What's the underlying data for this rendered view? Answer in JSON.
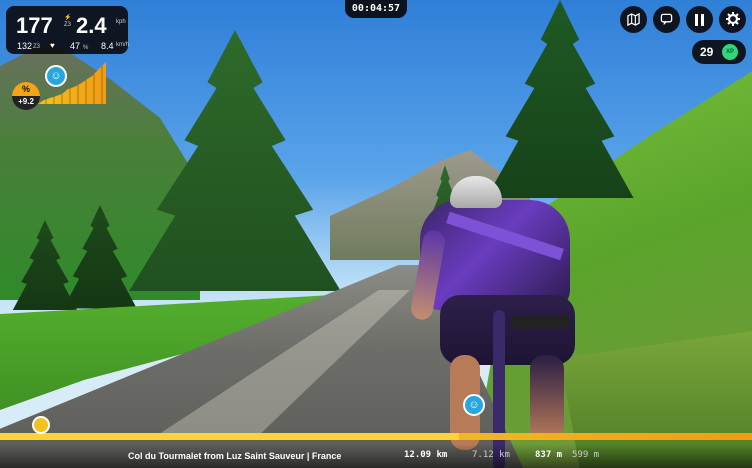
{
  "stats": {
    "power": "177",
    "power_zone_top": "⚡",
    "power_zone": "Z3",
    "speed": "2.4",
    "speed_unit": "kph",
    "heart_rate": "132",
    "heart_zone": "Z3",
    "heart_icon": "heart-icon",
    "cadence": "47",
    "cadence_unit": "%",
    "distance": "8.4",
    "distance_unit": "km/h"
  },
  "grade": {
    "icon_text": "%",
    "value": "+9.2"
  },
  "timer": "00:04:57",
  "controls": {
    "map_icon": "map-icon",
    "chat_icon": "chat-icon",
    "pause_icon": "pause-icon",
    "settings_icon": "gear-icon"
  },
  "xp": {
    "value": "29",
    "badge": "XP"
  },
  "route": {
    "name": "Col du Tourmalet from Luz Saint Sauveur | France",
    "total_distance": "12.09 km",
    "remaining_distance": "7.12 km",
    "elevation_gain": "837 m",
    "remaining_elevation": "599 m",
    "progress_fraction": 0.61
  },
  "colors": {
    "accent_orange": "#f5a81a",
    "accent_blue": "#27a6e0",
    "xp_green": "#2fd67a"
  }
}
